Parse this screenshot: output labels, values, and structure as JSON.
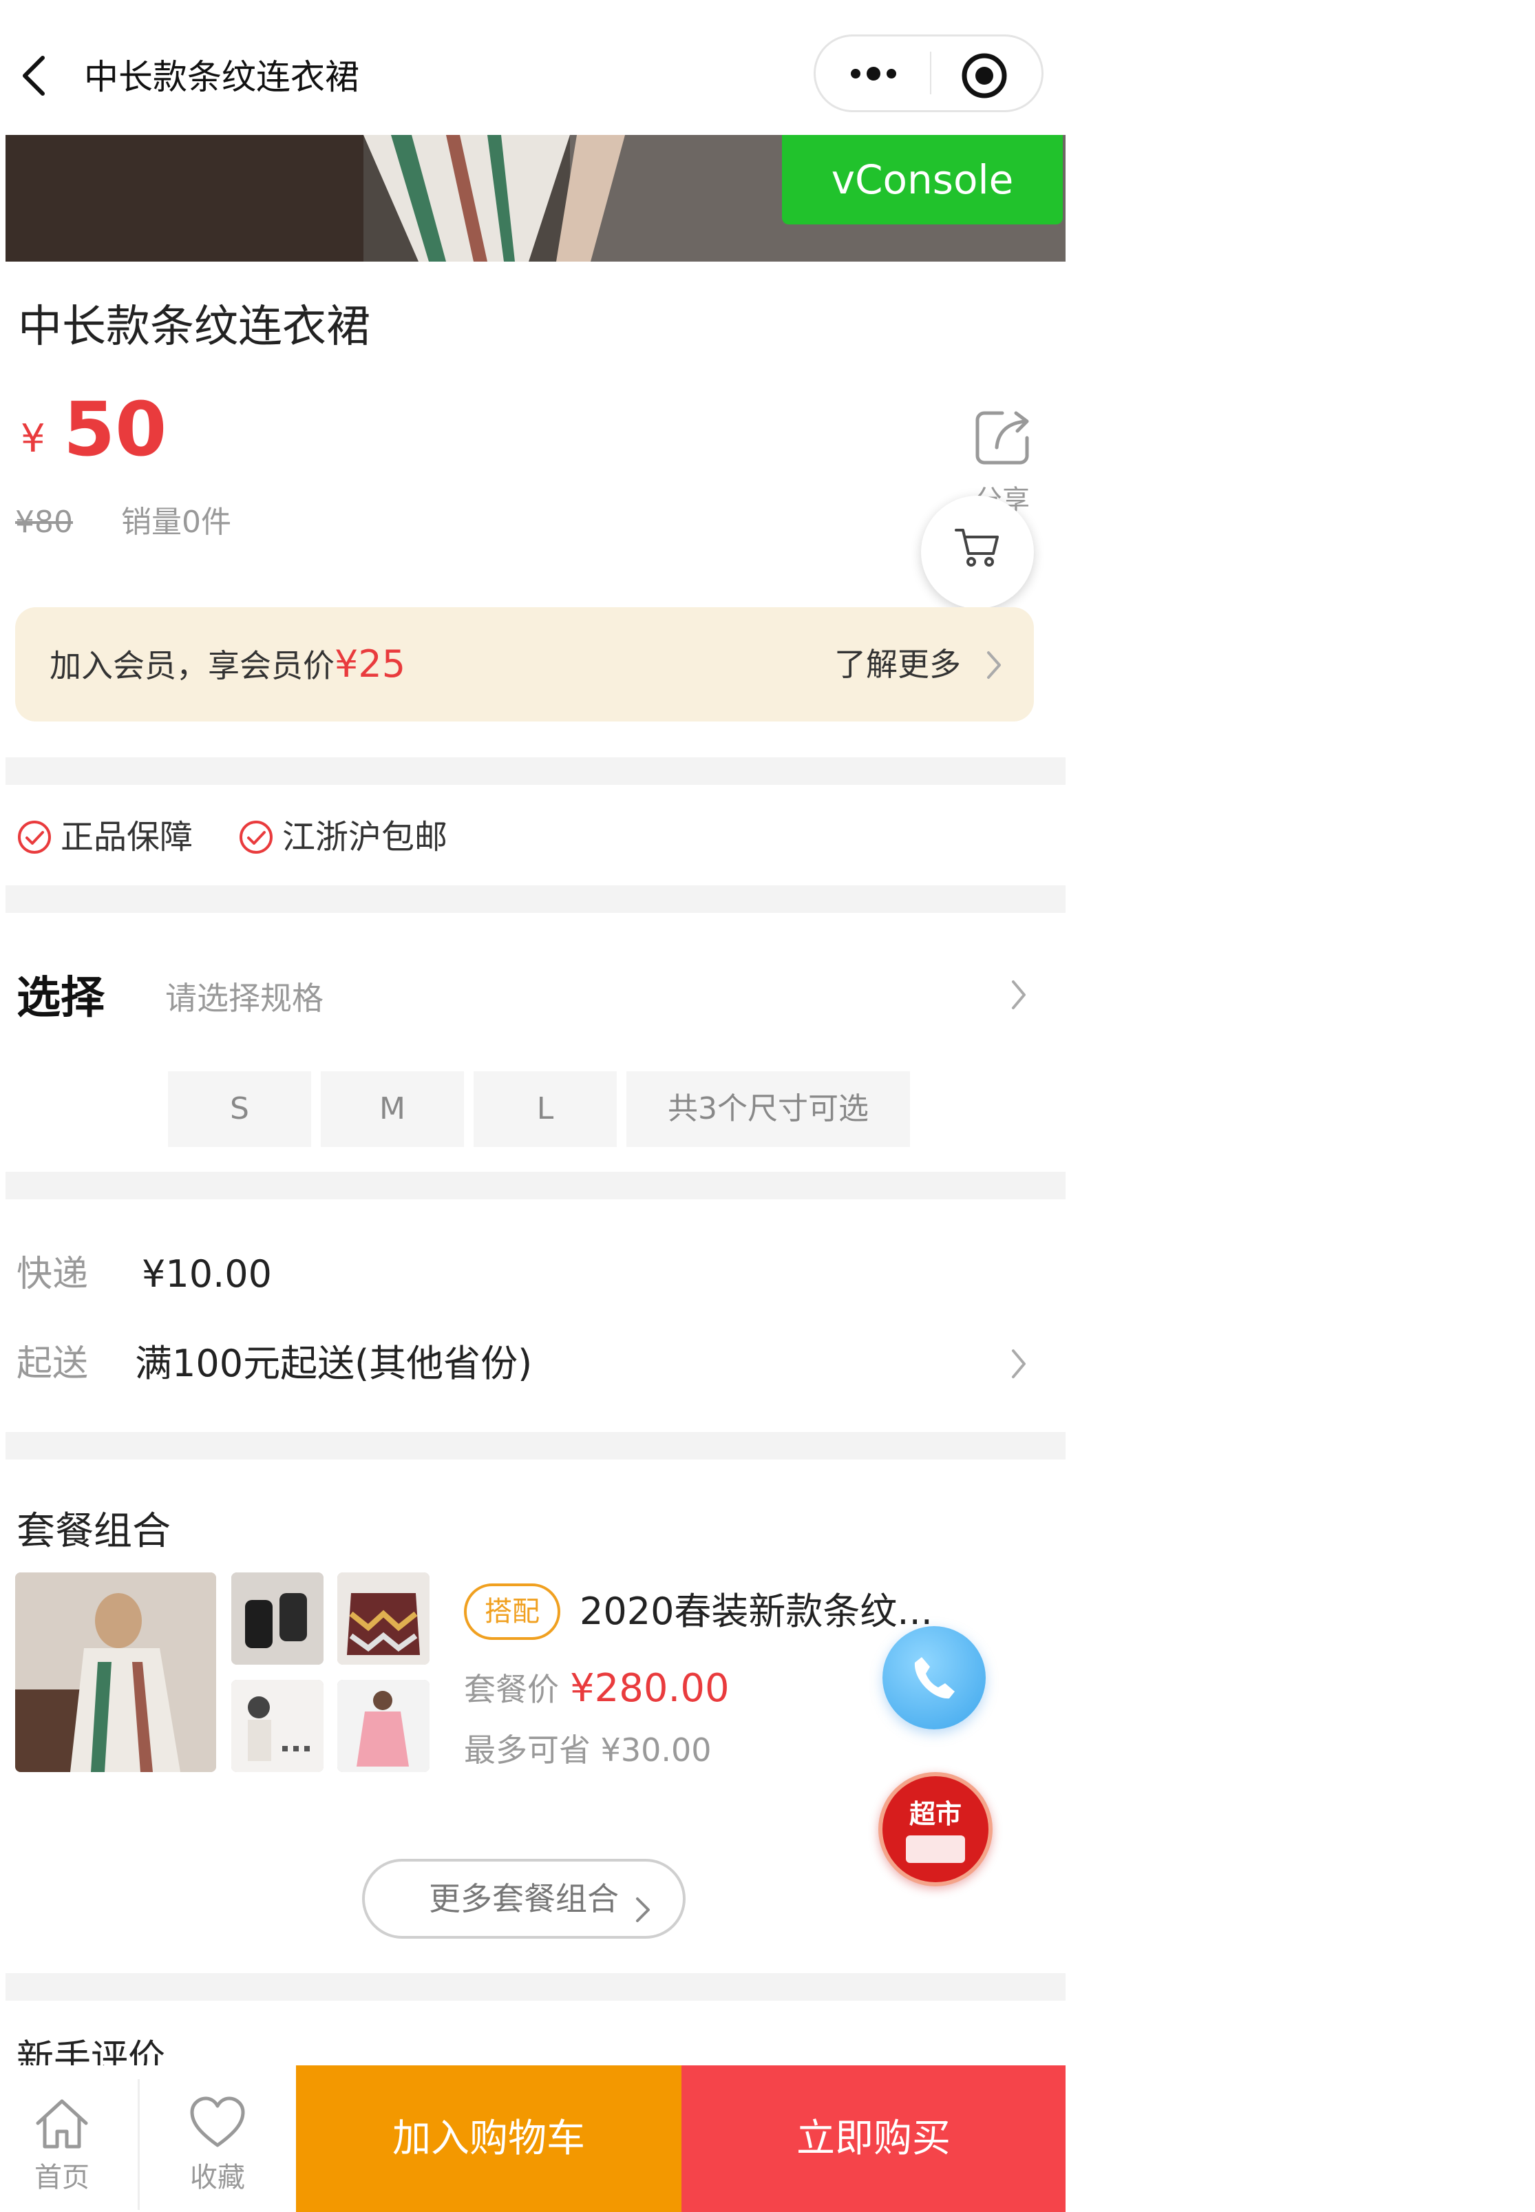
{
  "nav": {
    "title": "中长款条纹连衣裙",
    "icons": [
      "back-icon",
      "more-icon",
      "target-icon"
    ]
  },
  "debug": {
    "vconsole_label": "vConsole"
  },
  "product": {
    "title": "中长款条纹连衣裙",
    "currency": "¥",
    "price": "50",
    "original_price": "¥80",
    "sales": "销量0件",
    "share_label": "分享"
  },
  "member": {
    "text": "加入会员，享会员价",
    "price": "¥25",
    "more_label": "了解更多"
  },
  "guarantees": [
    "正品保障",
    "江浙沪包邮"
  ],
  "select": {
    "label": "选择",
    "hint": "请选择规格",
    "sizes": [
      "S",
      "M",
      "L"
    ],
    "count_label": "共3个尺寸可选"
  },
  "shipping": {
    "express_label": "快递",
    "express_value": "¥10.00",
    "min_label": "起送",
    "min_value": "满100元起送(其他省份)"
  },
  "combo": {
    "section_title": "套餐组合",
    "tag": "搭配",
    "name": "2020春装新款条纹...",
    "price_label": "套餐价",
    "price": "¥280.00",
    "save_text": "最多可省 ¥30.00",
    "more_button": "更多套餐组合"
  },
  "floating": {
    "market_label": "超市"
  },
  "reviews": {
    "title": "新手评价"
  },
  "bottom_bar": {
    "home_label": "首页",
    "fav_label": "收藏",
    "add_cart_label": "加入购物车",
    "buy_now_label": "立即购买"
  },
  "colors": {
    "accent_red": "#e93b3d",
    "cart_orange": "#f39800",
    "buy_red": "#f5444a",
    "vconsole_green": "#21c22c"
  }
}
